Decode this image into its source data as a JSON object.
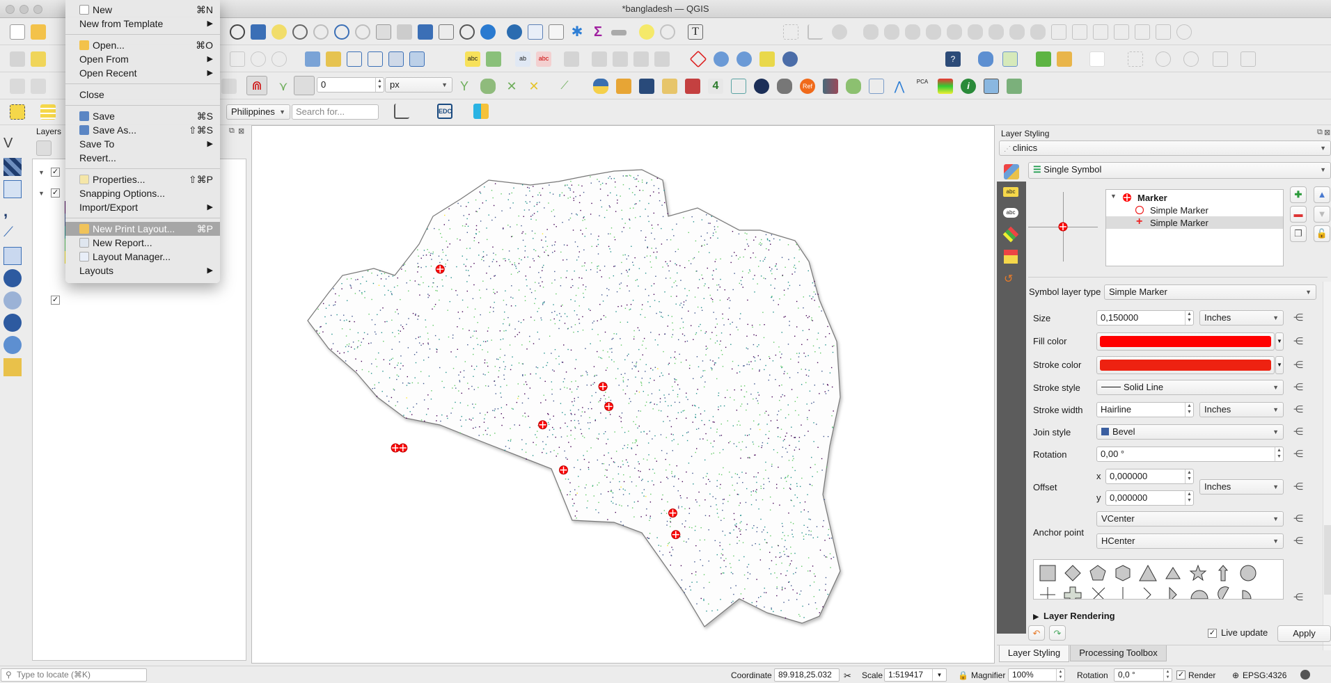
{
  "window": {
    "title": "*bangladesh — QGIS"
  },
  "file_menu": {
    "items": [
      {
        "label": "New",
        "shortcut": "⌘N",
        "icon": "new-file-icon"
      },
      {
        "label": "New from Template",
        "submenu": true
      },
      {
        "separator": true
      },
      {
        "label": "Open...",
        "shortcut": "⌘O",
        "icon": "folder-icon"
      },
      {
        "label": "Open From",
        "submenu": true
      },
      {
        "label": "Open Recent",
        "submenu": true
      },
      {
        "separator": true
      },
      {
        "label": "Close"
      },
      {
        "separator": true
      },
      {
        "label": "Save",
        "shortcut": "⌘S",
        "icon": "save-icon"
      },
      {
        "label": "Save As...",
        "shortcut": "⇧⌘S",
        "icon": "save-as-icon"
      },
      {
        "label": "Save To",
        "submenu": true
      },
      {
        "label": "Revert..."
      },
      {
        "separator": true
      },
      {
        "label": "Properties...",
        "shortcut": "⇧⌘P",
        "icon": "properties-icon"
      },
      {
        "label": "Snapping Options..."
      },
      {
        "label": "Import/Export",
        "submenu": true
      },
      {
        "separator": true
      },
      {
        "label": "New Print Layout...",
        "shortcut": "⌘P",
        "icon": "print-layout-icon",
        "highlighted": true
      },
      {
        "label": "New Report...",
        "icon": "report-icon"
      },
      {
        "label": "Layout Manager...",
        "icon": "layout-manager-icon"
      },
      {
        "label": "Layouts",
        "submenu": true
      }
    ]
  },
  "snapping_toolbar": {
    "tolerance": "0",
    "units": "px"
  },
  "locator_toolbar": {
    "country": "Philippines",
    "search_placeholder": "Search for..."
  },
  "layers_panel": {
    "title": "Layers"
  },
  "layer_styling": {
    "title": "Layer Styling",
    "layer": "clinics",
    "renderer": "Single Symbol",
    "symbol_tree": [
      {
        "label": "Marker",
        "bold": true
      },
      {
        "label": "Simple Marker",
        "icon": "circle-outline"
      },
      {
        "label": "Simple Marker",
        "icon": "red-cross",
        "selected": true
      }
    ],
    "symbol_layer_type_label": "Symbol layer type",
    "symbol_layer_type": "Simple Marker",
    "props": {
      "size_label": "Size",
      "size": "0,150000",
      "size_unit": "Inches",
      "fill_label": "Fill color",
      "fill_color": "#ff0000",
      "stroke_color_label": "Stroke color",
      "stroke_color": "#ee2211",
      "stroke_style_label": "Stroke style",
      "stroke_style": "Solid Line",
      "stroke_width_label": "Stroke width",
      "stroke_width": "Hairline",
      "stroke_width_unit": "Inches",
      "join_style_label": "Join style",
      "join_style": "Bevel",
      "rotation_label": "Rotation",
      "rotation": "0,00 °",
      "offset_label": "Offset",
      "offset_x_label": "x",
      "offset_x": "0,000000",
      "offset_y_label": "y",
      "offset_y": "0,000000",
      "offset_unit": "Inches",
      "anchor_label": "Anchor point",
      "anchor_v": "VCenter",
      "anchor_h": "HCenter"
    },
    "layer_rendering": "Layer Rendering",
    "live_update": "Live update",
    "live_update_checked": true,
    "apply": "Apply",
    "tabs": [
      "Layer Styling",
      "Processing Toolbox"
    ]
  },
  "statusbar": {
    "locate_placeholder": "Type to locate (⌘K)",
    "coordinate_label": "Coordinate",
    "coordinate": "89.918,25.032",
    "scale_label": "Scale",
    "scale": "1:519417",
    "magnifier_label": "Magnifier",
    "magnifier": "100%",
    "rotation_label": "Rotation",
    "rotation": "0,0 °",
    "render_label": "Render",
    "render_checked": true,
    "crs": "EPSG:4326"
  },
  "map": {
    "clinic_markers": [
      {
        "x": 0.253,
        "y": 0.137
      },
      {
        "x": 0.472,
        "y": 0.355
      },
      {
        "x": 0.48,
        "y": 0.392
      },
      {
        "x": 0.391,
        "y": 0.426
      },
      {
        "x": 0.193,
        "y": 0.469
      },
      {
        "x": 0.203,
        "y": 0.469
      },
      {
        "x": 0.419,
        "y": 0.51
      },
      {
        "x": 0.566,
        "y": 0.59
      },
      {
        "x": 0.57,
        "y": 0.63
      }
    ]
  }
}
